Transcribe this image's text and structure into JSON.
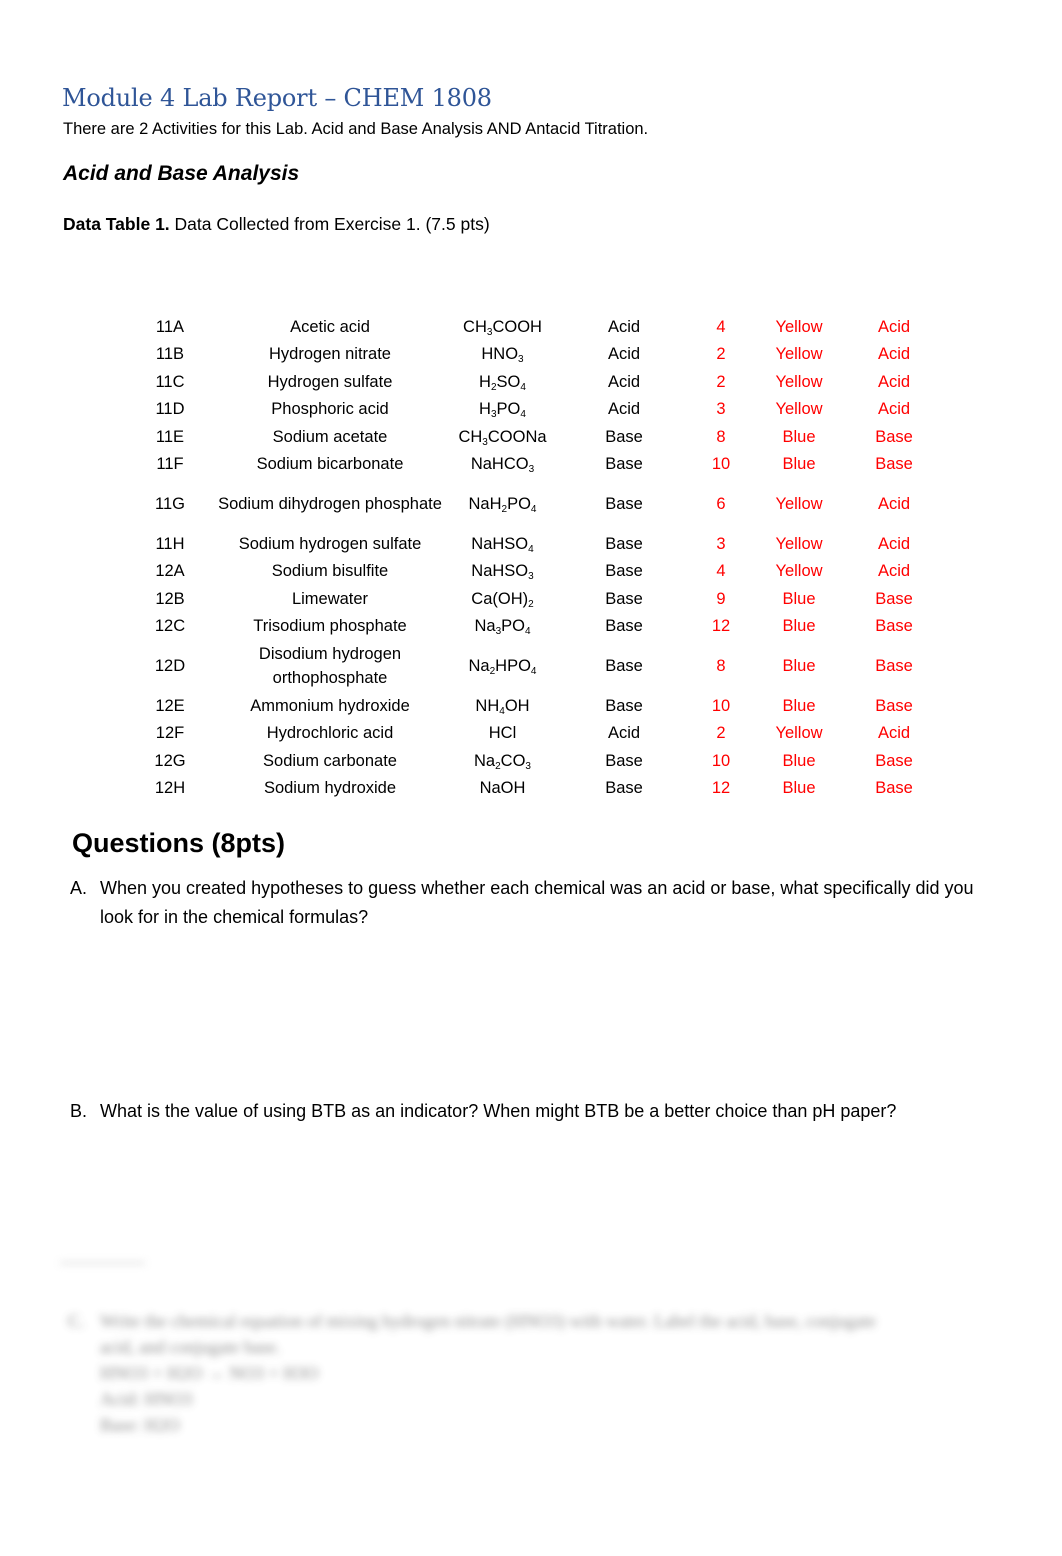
{
  "title": "Module 4 Lab Report – CHEM 1808",
  "intro": "There are 2 Activities for this Lab. Acid and Base Analysis AND Antacid Titration.",
  "section_heading": "Acid and Base Analysis",
  "table_caption": {
    "bold": "Data Table 1.",
    "rest": " Data Collected from Exercise 1. (7.5 pts)"
  },
  "rows": [
    {
      "id": "11A",
      "name": "Acetic acid",
      "formula": [
        [
          "CH",
          ""
        ],
        [
          "3",
          "sub"
        ],
        [
          "COOH",
          ""
        ]
      ],
      "hypothesis": "Acid",
      "ph": "4",
      "btb": "Yellow",
      "result": "Acid"
    },
    {
      "id": "11B",
      "name": "Hydrogen nitrate",
      "formula": [
        [
          "HNO",
          ""
        ],
        [
          "3",
          "sub"
        ]
      ],
      "hypothesis": "Acid",
      "ph": "2",
      "btb": "Yellow",
      "result": "Acid"
    },
    {
      "id": "11C",
      "name": "Hydrogen sulfate",
      "formula": [
        [
          "H",
          ""
        ],
        [
          "2",
          "sub"
        ],
        [
          "SO",
          ""
        ],
        [
          "4",
          "sub"
        ]
      ],
      "hypothesis": "Acid",
      "ph": "2",
      "btb": "Yellow",
      "result": "Acid"
    },
    {
      "id": "11D",
      "name": "Phosphoric acid",
      "formula": [
        [
          "H",
          ""
        ],
        [
          "3",
          "sub"
        ],
        [
          "PO",
          ""
        ],
        [
          "4",
          "sub"
        ]
      ],
      "hypothesis": "Acid",
      "ph": "3",
      "btb": "Yellow",
      "result": "Acid"
    },
    {
      "id": "11E",
      "name": "Sodium acetate",
      "formula": [
        [
          "CH",
          ""
        ],
        [
          "3",
          "sub"
        ],
        [
          "COONa",
          ""
        ]
      ],
      "hypothesis": "Base",
      "ph": "8",
      "btb": "Blue",
      "result": "Base"
    },
    {
      "id": "11F",
      "name": "Sodium bicarbonate",
      "formula": [
        [
          "NaHCO",
          ""
        ],
        [
          "3",
          "sub"
        ]
      ],
      "hypothesis": "Base",
      "ph": "10",
      "btb": "Blue",
      "result": "Base"
    },
    {
      "id": "11G",
      "name": "Sodium dihydrogen phosphate",
      "formula": [
        [
          "NaH",
          ""
        ],
        [
          "2",
          "sub"
        ],
        [
          "PO",
          ""
        ],
        [
          "4",
          "sub"
        ]
      ],
      "hypothesis": "Base",
      "ph": "6",
      "btb": "Yellow",
      "result": "Acid",
      "tall": true
    },
    {
      "id": "11H",
      "name": "Sodium hydrogen sulfate",
      "formula": [
        [
          "NaHSO",
          ""
        ],
        [
          "4",
          "sub"
        ]
      ],
      "hypothesis": "Base",
      "ph": "3",
      "btb": "Yellow",
      "result": "Acid"
    },
    {
      "id": "12A",
      "name": "Sodium bisulfite",
      "formula": [
        [
          "NaHSO",
          ""
        ],
        [
          "3",
          "sub"
        ]
      ],
      "hypothesis": "Base",
      "ph": "4",
      "btb": "Yellow",
      "result": "Acid"
    },
    {
      "id": "12B",
      "name": "Limewater",
      "formula": [
        [
          "Ca(OH)",
          ""
        ],
        [
          "2",
          "sub"
        ]
      ],
      "hypothesis": "Base",
      "ph": "9",
      "btb": "Blue",
      "result": "Base"
    },
    {
      "id": "12C",
      "name": "Trisodium phosphate",
      "formula": [
        [
          "Na",
          ""
        ],
        [
          "3",
          "sub"
        ],
        [
          "PO",
          ""
        ],
        [
          "4",
          "sub"
        ]
      ],
      "hypothesis": "Base",
      "ph": "12",
      "btb": "Blue",
      "result": "Base"
    },
    {
      "id": "12D",
      "name": "Disodium hydrogen orthophosphate",
      "formula": [
        [
          "Na",
          ""
        ],
        [
          "2",
          "sub"
        ],
        [
          "HPO",
          ""
        ],
        [
          "4",
          "sub"
        ]
      ],
      "hypothesis": "Base",
      "ph": "8",
      "btb": "Blue",
      "result": "Base",
      "tall": true
    },
    {
      "id": "12E",
      "name": "Ammonium hydroxide",
      "formula": [
        [
          "NH",
          ""
        ],
        [
          "4",
          "sub"
        ],
        [
          "OH",
          ""
        ]
      ],
      "hypothesis": "Base",
      "ph": "10",
      "btb": "Blue",
      "result": "Base"
    },
    {
      "id": "12F",
      "name": "Hydrochloric acid",
      "formula": [
        [
          "HCl",
          ""
        ]
      ],
      "hypothesis": "Acid",
      "ph": "2",
      "btb": "Yellow",
      "result": "Acid"
    },
    {
      "id": "12G",
      "name": "Sodium carbonate",
      "formula": [
        [
          "Na",
          ""
        ],
        [
          "2",
          "sub"
        ],
        [
          "CO",
          ""
        ],
        [
          "3",
          "sub"
        ]
      ],
      "hypothesis": "Base",
      "ph": "10",
      "btb": "Blue",
      "result": "Base"
    },
    {
      "id": "12H",
      "name": "Sodium hydroxide",
      "formula": [
        [
          "NaOH",
          ""
        ]
      ],
      "hypothesis": "Base",
      "ph": "12",
      "btb": "Blue",
      "result": "Base"
    }
  ],
  "questions_heading": "Questions (8pts)",
  "questions": [
    {
      "label": "A.",
      "text": "When you created hypotheses to guess whether each chemical was an acid or base, what specifically did you look for in the chemical formulas?"
    },
    {
      "label": "B.",
      "text": "What is the value of using BTB as an indicator? When might BTB be a better choice than pH paper?"
    }
  ],
  "blurred_question": {
    "label": "C.",
    "lines": [
      "Write the chemical equation of mixing hydrogen nitrate (HNO3) with water. Label the acid, base, conjugate",
      "acid, and conjugate base.",
      "HNO3 + H2O → NO3 + H3O",
      "Acid: HNO3",
      "Base: H2O"
    ]
  },
  "colors": {
    "title": "#2f5597",
    "answer": "#ff0000"
  }
}
